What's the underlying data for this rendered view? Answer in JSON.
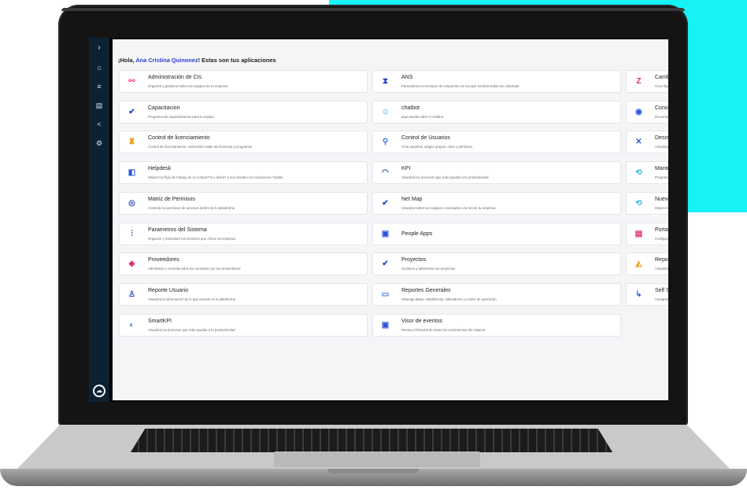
{
  "greeting": {
    "prefix": "¡Hola, ",
    "name": "Ana Cristina Quinonez",
    "suffix": "! Estas son tus aplicaciones"
  },
  "sidebar": {
    "expand_glyph": "›"
  },
  "apps": {
    "col1": [
      {
        "title": "Administración de CIs",
        "desc": "Organiza y gestiona todos los equipos de tu empresa",
        "icon": "link-icon",
        "color": "#ff4f7b",
        "glyph": "⚯"
      },
      {
        "title": "Capacitacion",
        "desc": "Programa las capacitaciones para tu equipo",
        "icon": "check-icon",
        "color": "#2846c7",
        "glyph": "✔"
      },
      {
        "title": "Control de licenciamiento",
        "desc": "Control de licenciamiento, Administra todas tus licencias y programas",
        "icon": "license-icon",
        "color": "#f29b18",
        "glyph": "♜"
      },
      {
        "title": "Helpdesk",
        "desc": "Mejore los flujo de trabajo de su compa??a y deleit? a sus clientes con soluciones r?pidas",
        "icon": "helpdesk-icon",
        "color": "#2a57e0",
        "glyph": "◧"
      },
      {
        "title": "Matriz de Permisos",
        "desc": "Controla los permisos de accesos dentro de tu plataforma",
        "icon": "permissions-icon",
        "color": "#304fb0",
        "glyph": "◎"
      },
      {
        "title": "Parametros del Sistema",
        "desc": "Organice y estructure los servicios que ofrece su empresa",
        "icon": "sliders-icon",
        "color": "#3a3ac9",
        "glyph": "⫶"
      },
      {
        "title": "Proveedores",
        "desc": "Administra y controla todos los contratos con tus proveedores",
        "icon": "cube-icon",
        "color": "#e0246b",
        "glyph": "◈"
      },
      {
        "title": "Reporte Usuario",
        "desc": "Visualiza la información de lo que sucede en la plataforma",
        "icon": "user-report-icon",
        "color": "#2845c8",
        "glyph": "♙"
      },
      {
        "title": "SmartKPI",
        "desc": "Visualiza los procesos que más ayudan a tu productividad",
        "icon": "smartkpi-icon",
        "color": "#2a7be8",
        "glyph": "◐"
      }
    ],
    "col2": [
      {
        "title": "ANS",
        "desc": "Parametriza los tiempos de respuesta con los que medirás todas tus solicitude",
        "icon": "hourglass-icon",
        "color": "#2c3ec8",
        "glyph": "⧗"
      },
      {
        "title": "chatbot",
        "desc": "aqui puedes abrir el chatbot",
        "icon": "chatbot-icon",
        "color": "#2a8df0",
        "glyph": "☺"
      },
      {
        "title": "Control de Usuarios",
        "desc": "Crea usuarios, asigne grupos, roles y permisos.",
        "icon": "users-control-icon",
        "color": "#2a6ee8",
        "glyph": "⚲"
      },
      {
        "title": "KPI",
        "desc": "Visualiza los procesos que más ayudan a tu productividad",
        "icon": "gauge-icon",
        "color": "#1e4ea8",
        "glyph": "◠"
      },
      {
        "title": "Net Map",
        "desc": "Visualiza todos tus equipos conectados a la red de tu empresa",
        "icon": "netmap-icon",
        "color": "#2846c7",
        "glyph": "✔"
      },
      {
        "title": "People Apps",
        "desc": "",
        "icon": "people-apps-icon",
        "color": "#2e50d8",
        "glyph": "▣"
      },
      {
        "title": "Proyectos",
        "desc": "Gestiona y administra tus proyectos",
        "icon": "projects-icon",
        "color": "#2846c7",
        "glyph": "✔"
      },
      {
        "title": "Reportes Generales",
        "desc": "Obtenga datos, estadísticas, indicadores y costos de operación",
        "icon": "reports-icon",
        "color": "#3a6fe0",
        "glyph": "▭"
      },
      {
        "title": "Visor de eventos",
        "desc": "Revisa el historial de todos los movimientos del sistema",
        "icon": "events-icon",
        "color": "#2e50d8",
        "glyph": "▣"
      }
    ],
    "col3": [
      {
        "title": "Cambio",
        "desc": "Crea flujo",
        "icon": "change-icon",
        "color": "#e0246b",
        "glyph": "Z"
      },
      {
        "title": "Conoci",
        "desc": "Documen",
        "icon": "knowledge-icon",
        "color": "#2a57e0",
        "glyph": "◉"
      },
      {
        "title": "Descut",
        "desc": "Visualiza",
        "icon": "close-icon",
        "color": "#2a57e0",
        "glyph": "✕"
      },
      {
        "title": "Manten",
        "desc": "Programa",
        "icon": "maintenance-icon",
        "color": "#2ab0e0",
        "glyph": "⟲"
      },
      {
        "title": "Nuevo",
        "desc": "Mejore lo",
        "icon": "new-icon",
        "color": "#2ab0e0",
        "glyph": "⟲"
      },
      {
        "title": "Portafo",
        "desc": "Configura",
        "icon": "portfolio-icon",
        "color": "#e0246b",
        "glyph": "▤"
      },
      {
        "title": "Report",
        "desc": "Visualiza",
        "icon": "report-icon",
        "color": "#f29b18",
        "glyph": "◭"
      },
      {
        "title": "Self Se",
        "desc": "Autogesti",
        "icon": "self-service-icon",
        "color": "#2a57e0",
        "glyph": "↳"
      }
    ]
  }
}
